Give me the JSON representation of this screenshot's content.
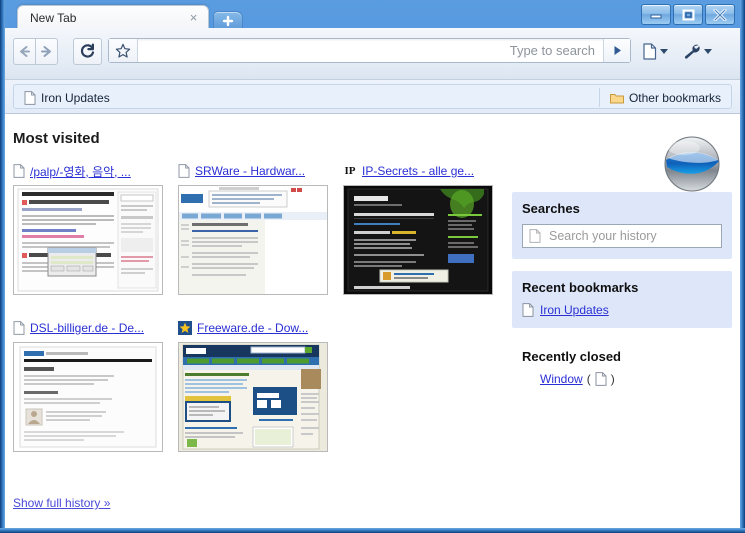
{
  "window": {
    "controls": [
      {
        "name": "minimize",
        "label": "Minimize"
      },
      {
        "name": "maximize",
        "label": "Maximize"
      },
      {
        "name": "close",
        "label": "Close"
      }
    ]
  },
  "tabstrip": {
    "tab_title": "New Tab",
    "close_glyph": "×",
    "new_tab_label": "+"
  },
  "toolbar": {
    "back_label": "Back",
    "forward_label": "Forward",
    "reload_label": "Reload",
    "bookmark_star_label": "Bookmark this page",
    "omnibox_value": "",
    "omnibox_placeholder": "",
    "omnibox_hint": "Type to search",
    "go_label": "Go",
    "page_menu_label": "Page menu",
    "wrench_menu_label": "Customize and control"
  },
  "bookmarks_bar": {
    "items": [
      {
        "icon": "page-icon",
        "label": "Iron Updates"
      }
    ],
    "other_bookmarks": {
      "icon": "folder-icon",
      "label": "Other bookmarks"
    }
  },
  "new_tab_page": {
    "most_visited_title": "Most visited",
    "show_full_history": "Show full history »",
    "logo_name": "iron-logo",
    "thumbnails": [
      {
        "favicon": "page-icon",
        "title": "/palp/-영화, 음악, ...",
        "style": "korean-forum"
      },
      {
        "favicon": "page-icon",
        "title": "SRWare - Hardwar...",
        "style": "srware"
      },
      {
        "favicon": "ip-icon",
        "favicon_text": "IP",
        "title": "IP-Secrets - alle ge...",
        "style": "ipsecrets"
      },
      {
        "favicon": "page-icon",
        "title": "DSL-billiger.de - De...",
        "style": "dslbilliger"
      },
      {
        "favicon": "star-icon",
        "title": "Freeware.de - Dow...",
        "style": "freeware"
      }
    ]
  },
  "sidebar": {
    "searches": {
      "title": "Searches",
      "input_value": "",
      "input_placeholder": "Search your history",
      "input_icon": "page-icon"
    },
    "recent_bookmarks": {
      "title": "Recent bookmarks",
      "items": [
        {
          "icon": "page-icon",
          "label": "Iron Updates"
        }
      ]
    },
    "recently_closed": {
      "title": "Recently closed",
      "items": [
        {
          "label": "Window",
          "open_paren": "(",
          "icon": "page-icon",
          "close_paren": ")"
        }
      ]
    }
  },
  "colors": {
    "frame_blue": "#3f8bd8",
    "panel_blue": "#dde7f9",
    "link_blue": "#2b30d4",
    "bookmark_bar": "#e8f0fb"
  }
}
